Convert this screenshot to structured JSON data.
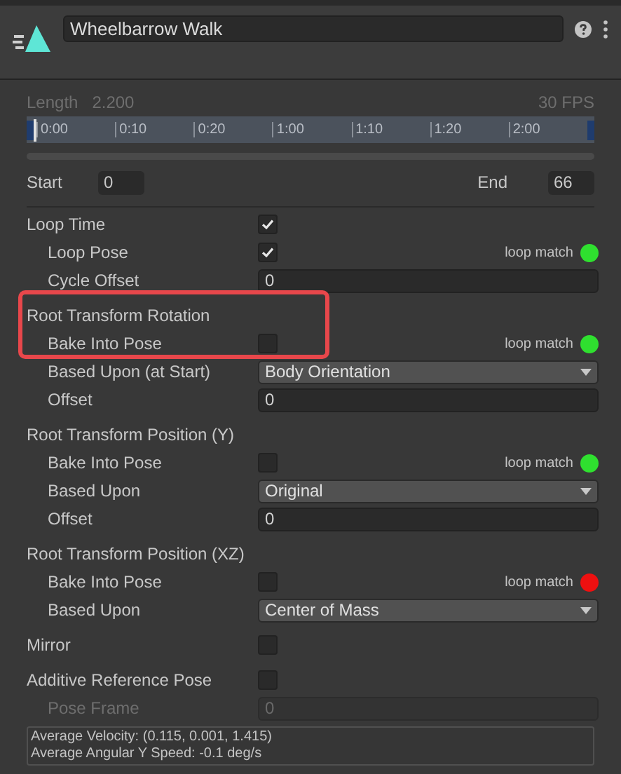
{
  "header": {
    "title": "Wheelbarrow Walk"
  },
  "timing": {
    "length_label": "Length",
    "length": "2.200",
    "fps": "30 FPS",
    "ticks": [
      "0:00",
      "0:10",
      "0:20",
      "1:00",
      "1:10",
      "1:20",
      "2:00"
    ],
    "start_label": "Start",
    "start": "0",
    "end_label": "End",
    "end": "66"
  },
  "groups": [
    {
      "kind": "checkbox",
      "label": "Loop Time",
      "checked": true,
      "highlighted": false,
      "children": [
        {
          "kind": "checkbox",
          "label": "Loop Pose",
          "checked": true,
          "indicator": {
            "label": "loop match",
            "color": "#2fe02f"
          }
        },
        {
          "kind": "number",
          "label": "Cycle Offset",
          "value": "0",
          "disabled": false
        }
      ]
    },
    {
      "kind": "heading",
      "label": "Root Transform Rotation",
      "highlighted": true,
      "children": [
        {
          "kind": "checkbox",
          "label": "Bake Into Pose",
          "checked": false,
          "indicator": {
            "label": "loop match",
            "color": "#2fe02f"
          }
        },
        {
          "kind": "dropdown",
          "label": "Based Upon (at Start)",
          "value": "Body Orientation"
        },
        {
          "kind": "number",
          "label": "Offset",
          "value": "0",
          "disabled": false
        }
      ]
    },
    {
      "kind": "heading",
      "label": "Root Transform Position (Y)",
      "highlighted": false,
      "children": [
        {
          "kind": "checkbox",
          "label": "Bake Into Pose",
          "checked": false,
          "indicator": {
            "label": "loop match",
            "color": "#2fe02f"
          }
        },
        {
          "kind": "dropdown",
          "label": "Based Upon",
          "value": "Original"
        },
        {
          "kind": "number",
          "label": "Offset",
          "value": "0",
          "disabled": false
        }
      ]
    },
    {
      "kind": "heading",
      "label": "Root Transform Position (XZ)",
      "highlighted": false,
      "children": [
        {
          "kind": "checkbox",
          "label": "Bake Into Pose",
          "checked": false,
          "indicator": {
            "label": "loop match",
            "color": "#ee1010"
          }
        },
        {
          "kind": "dropdown",
          "label": "Based Upon",
          "value": "Center of Mass"
        }
      ]
    },
    {
      "kind": "checkbox",
      "label": "Mirror",
      "checked": false,
      "highlighted": false
    },
    {
      "kind": "checkbox",
      "label": "Additive Reference Pose",
      "checked": false,
      "highlighted": false,
      "children": [
        {
          "kind": "number",
          "label": "Pose Frame",
          "value": "0",
          "disabled": true
        }
      ]
    }
  ],
  "info": [
    "Average Velocity: (0.115, 0.001, 1.415)",
    "Average Angular Y Speed: -0.1 deg/s"
  ]
}
